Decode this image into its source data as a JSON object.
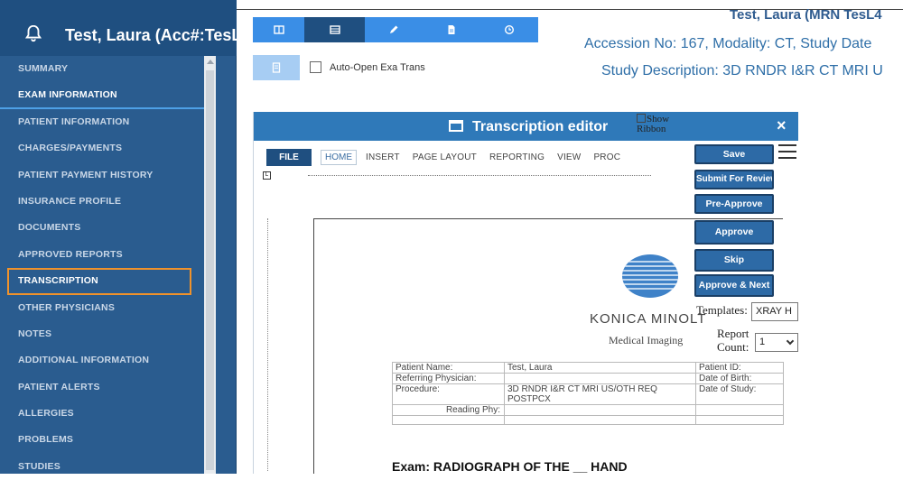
{
  "sidebar": {
    "title": "Test, Laura (Acc#:TesL",
    "items": [
      {
        "label": "SUMMARY"
      },
      {
        "label": "EXAM INFORMATION"
      },
      {
        "label": "PATIENT INFORMATION"
      },
      {
        "label": "CHARGES/PAYMENTS"
      },
      {
        "label": "PATIENT PAYMENT HISTORY"
      },
      {
        "label": "INSURANCE PROFILE"
      },
      {
        "label": "DOCUMENTS"
      },
      {
        "label": "APPROVED REPORTS"
      },
      {
        "label": "TRANSCRIPTION"
      },
      {
        "label": "OTHER PHYSICIANS"
      },
      {
        "label": "NOTES"
      },
      {
        "label": "ADDITIONAL INFORMATION"
      },
      {
        "label": "PATIENT ALERTS"
      },
      {
        "label": "ALLERGIES"
      },
      {
        "label": "PROBLEMS"
      },
      {
        "label": "STUDIES"
      }
    ]
  },
  "toolbar": {
    "auto_open_label": "Auto-Open Exa Trans"
  },
  "patient_header": {
    "name": "Test, Laura (MRN TesL4",
    "accession": "Accession No: 167, Modality: CT, Study Date",
    "description": "Study Description: 3D RNDR I&R CT MRI U"
  },
  "editor": {
    "title": "Transcription editor",
    "close": "×",
    "ribbon": {
      "file": "FILE",
      "home": "HOME",
      "tabs": [
        "INSERT",
        "PAGE LAYOUT",
        "REPORTING",
        "VIEW",
        "PROC"
      ],
      "show_ribbon_1": "Show",
      "show_ribbon_2": "Ribbon"
    },
    "ruler_marker": "L",
    "document": {
      "logo_text": "KONICA MINOLT",
      "logo_sub": "Medical Imaging",
      "table": {
        "patient_name_label": "Patient Name:",
        "patient_name": "Test, Laura",
        "patient_id_label": "Patient ID:",
        "ref_phys_label": "Referring Physician:",
        "dob_label": "Date of Birth:",
        "procedure_label": "Procedure:",
        "procedure": "3D RNDR I&R CT MRI US/OTH REQ POSTPCX",
        "date_study_label": "Date of Study:",
        "reading_phy_label": "Reading Phy:"
      },
      "exam": "Exam: RADIOGRAPH OF THE __ HAND"
    },
    "actions": {
      "save": "Save",
      "submit": "Submit For Review",
      "pre_approve": "Pre-Approve",
      "approve": "Approve",
      "skip": "Skip",
      "approve_next": "Approve & Next"
    },
    "templates_label": "Templates:",
    "templates_value": "XRAY H",
    "report_count_label_1": "Report",
    "report_count_label_2": "Count:",
    "report_count_value": "1"
  },
  "colors": {
    "sidebar_bg": "#2a5c8f",
    "accent_blue": "#3a8ee6",
    "editor_title": "#2f79b9",
    "highlight_outline": "#f0922b"
  },
  "icons": [
    "bell-icon",
    "columns-icon",
    "list-icon",
    "pencil-icon",
    "document-icon",
    "clock-icon",
    "document-light-icon",
    "close-icon",
    "hamburger-icon",
    "chevron-down-icon"
  ]
}
